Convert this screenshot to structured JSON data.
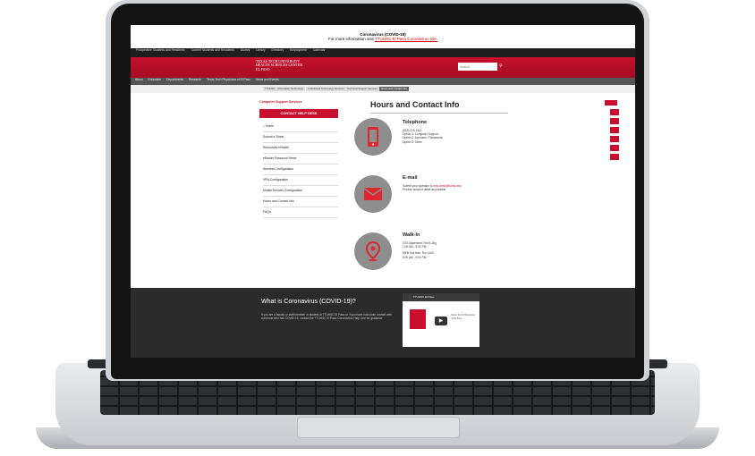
{
  "banner": {
    "title": "Coronavirus (COVID-19)",
    "line": "For more information visit",
    "link": "TTUHSC El Paso Coronavirus site."
  },
  "topnav": {
    "items": [
      "Prospective Students and Residents",
      "Current Students and Residents",
      "Alumni",
      "Library",
      "Directory",
      "Employment",
      "Calendar"
    ]
  },
  "header": {
    "logo_line1": "TEXAS TECH UNIVERSITY",
    "logo_line2": "HEALTH SCIENCES CENTER",
    "logo_line3": "EL PASO",
    "search_placeholder": "Search"
  },
  "secnav": {
    "items": [
      "About",
      "Education",
      "Departments",
      "Research",
      "Texas Tech Physicians of El Paso",
      "News and Events"
    ]
  },
  "tabs": {
    "items": [
      "TTUHSC",
      "Information Technology",
      "Institutional Technology Services",
      "Technical Support Services",
      "Hours and Contact Info"
    ]
  },
  "sidebar": {
    "title": "Computer Support Services",
    "cta": "CONTACT HELP DESK",
    "items": [
      "Home",
      "Submit a Ticket",
      "Resources eHealth",
      "eRaider Password Reset",
      "Wireless Configuration",
      "VPN Configuration",
      "Mobile Devices Configuration",
      "Hours and Contact Info",
      "FAQ's"
    ]
  },
  "main": {
    "title": "Hours and Contact Info",
    "phone_title": "Telephone",
    "phone_lines": [
      "(915) 215-4111",
      "Option 1: Computer Support",
      "Option 2: Accounts / Passwords",
      "Option 3: Other"
    ],
    "email_title": "E-mail",
    "email_line": "Submit your question to",
    "email_link": "help.desk@ttuhsc.edu",
    "email_line2": "Provide account detail as possible.",
    "walk_title": "Walk-In",
    "walk_lines": [
      "CSS Basement, Rm B-30g",
      "7:00 AM - 5:00 PM",
      "MEB 2nd floor, Rm 2100",
      "8:00 AM - 5:00 PM"
    ]
  },
  "footer": {
    "title": "What is Coronavirus (COVID-19)?",
    "text": "If you are a faculty or staff member or student at TTUHSC El Paso or if you have had close contact with someone who has COVID-19, contact the TTUHSC El Paso Coronavirus Help Line for guidance.",
    "video_title": "TTUHSC El Paso",
    "video_label": "Texas Tech Physicians of El Paso"
  },
  "colors": {
    "brand_red": "#c8102e",
    "dark": "#2b2b2b"
  },
  "icons": [
    "phone-icon",
    "envelope-icon",
    "location-pin-icon",
    "play-icon",
    "search-icon",
    "home-icon"
  ]
}
